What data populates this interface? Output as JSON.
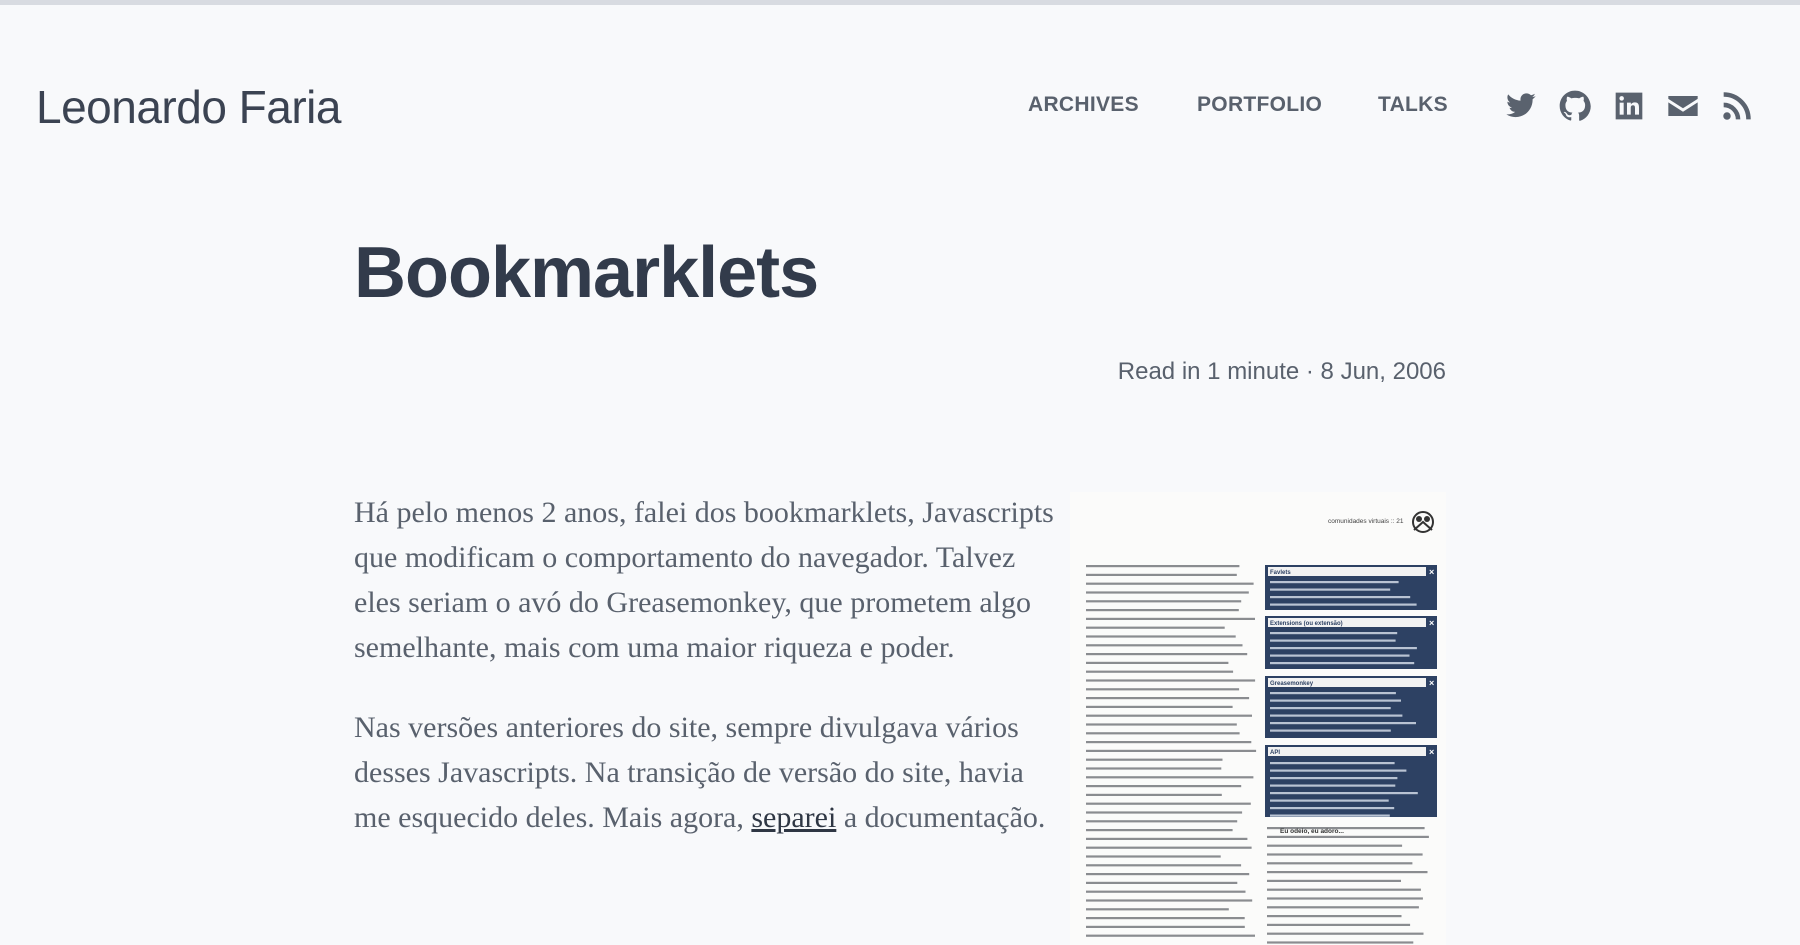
{
  "site": {
    "brand": "Leonardo Faria"
  },
  "nav": {
    "items": [
      "ARCHIVES",
      "PORTFOLIO",
      "TALKS"
    ]
  },
  "social": [
    "twitter-icon",
    "github-icon",
    "linkedin-icon",
    "email-icon",
    "rss-icon"
  ],
  "post": {
    "title": "Bookmarklets",
    "meta": "Read in 1 minute · 8 Jun, 2006",
    "p1": "Há pelo menos 2 anos, falei dos bookmarklets, Javascripts que modificam o comportamento do navegador. Talvez eles seriam o avó do Greasemonkey, que prometem algo semelhante, mais com uma maior riqueza e poder.",
    "p2_before": "Nas versões anteriores do site, sempre divulgava vários desses Javascripts. Na transição de versão do site, havia me esquecido deles. Mais agora, ",
    "p2_link": "separei",
    "p2_after": " a documentação."
  },
  "scan": {
    "header": "comunidades virtuais :: 21",
    "boxes": [
      "Favlets",
      "Extensions (ou extensão)",
      "Greasemonkey",
      "API"
    ],
    "section": "Eu odeio, eu adoro..."
  },
  "colors": {
    "background": "#f8f9fb",
    "text": "#3a4352",
    "muted": "#59616d",
    "box": "#2d4163"
  }
}
